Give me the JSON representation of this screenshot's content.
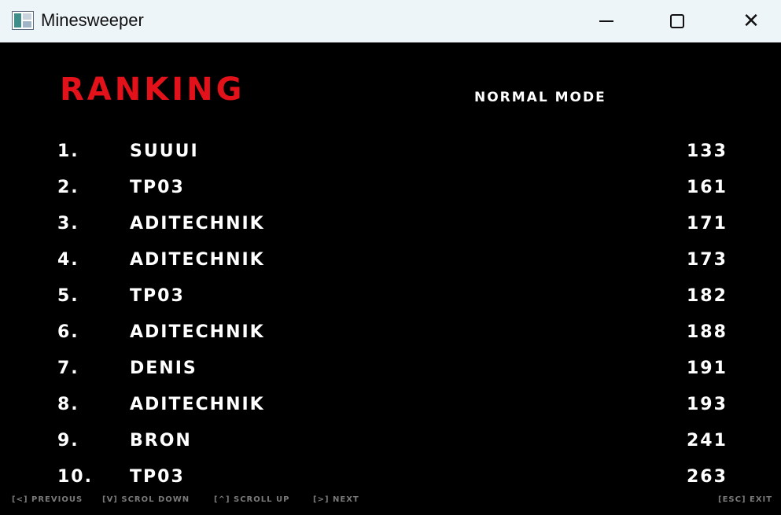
{
  "window": {
    "title": "Minesweeper"
  },
  "header": {
    "title": "RANKING",
    "mode": "NORMAL MODE"
  },
  "rows": [
    {
      "rank": "1.",
      "name": "SUUUI",
      "score": "133"
    },
    {
      "rank": "2.",
      "name": "TP03",
      "score": "161"
    },
    {
      "rank": "3.",
      "name": "ADITECHNIK",
      "score": "171"
    },
    {
      "rank": "4.",
      "name": "ADITECHNIK",
      "score": "173"
    },
    {
      "rank": "5.",
      "name": "TP03",
      "score": "182"
    },
    {
      "rank": "6.",
      "name": "ADITECHNIK",
      "score": "188"
    },
    {
      "rank": "7.",
      "name": "DENIS",
      "score": "191"
    },
    {
      "rank": "8.",
      "name": "ADITECHNIK",
      "score": "193"
    },
    {
      "rank": "9.",
      "name": "BRON",
      "score": "241"
    },
    {
      "rank": "10.",
      "name": "TP03",
      "score": "263"
    }
  ],
  "footer": {
    "previous": "[<] PREVIOUS",
    "scroll_down": "[V] SCROL DOWN",
    "scroll_up": "[^] SCROLL UP",
    "next": "[>] NEXT",
    "exit": "[ESC] EXIT"
  },
  "colors": {
    "heading": "#e3121a",
    "text": "#ffffff",
    "footer": "#7a7a7a",
    "background": "#000000",
    "titlebar": "#eef5f9"
  }
}
